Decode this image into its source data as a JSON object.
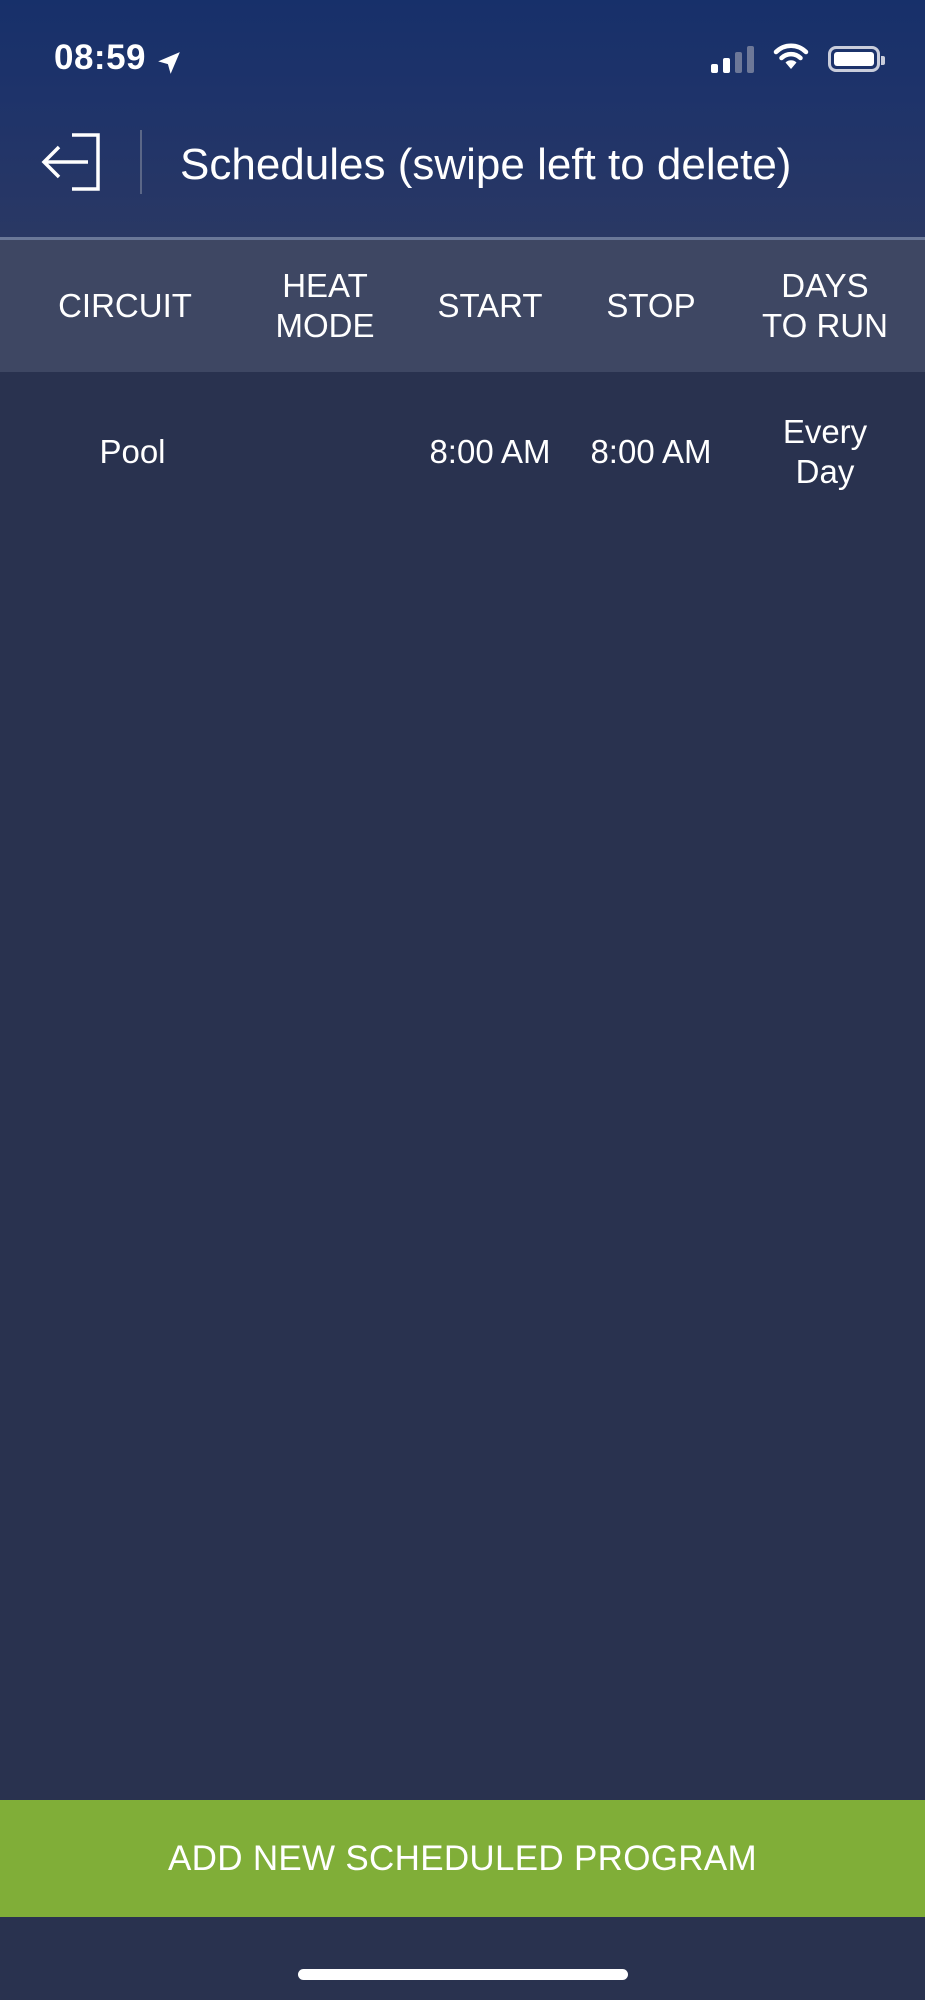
{
  "status_bar": {
    "time": "08:59",
    "icons": [
      "location-arrow-icon",
      "cellular-signal-icon",
      "wifi-icon",
      "battery-icon"
    ]
  },
  "header": {
    "back_icon": "exit-arrow-icon",
    "title": "Schedules (swipe left to delete)"
  },
  "table": {
    "columns": [
      {
        "key": "circuit",
        "label": "CIRCUIT"
      },
      {
        "key": "heat_mode",
        "label": "HEAT\nMODE"
      },
      {
        "key": "start",
        "label": "START"
      },
      {
        "key": "stop",
        "label": "STOP"
      },
      {
        "key": "days",
        "label": "DAYS\nTO RUN"
      }
    ],
    "rows": [
      {
        "circuit": "Pool",
        "heat_mode": "",
        "start": "8:00 AM",
        "stop": "8:00 AM",
        "days": "Every Day"
      }
    ]
  },
  "footer": {
    "add_button_label": "ADD NEW SCHEDULED PROGRAM"
  },
  "colors": {
    "background": "#29324f",
    "header_gradient_top": "#17306a",
    "table_header": "#3e4763",
    "add_button": "#80ae38",
    "text": "#ffffff"
  }
}
